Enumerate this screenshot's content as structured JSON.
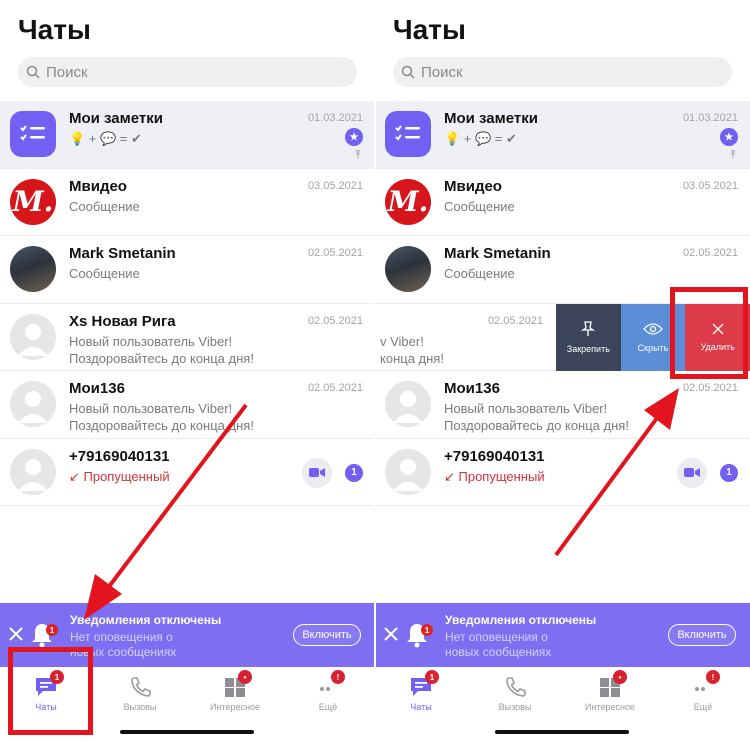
{
  "left": {
    "title": "Чаты",
    "search_placeholder": "Поиск",
    "chats": [
      {
        "name": "Мои заметки",
        "message": "💡 + 💬 = ✔",
        "date": "01.03.2021",
        "avatar": "notes-icon"
      },
      {
        "name": "Мвидео",
        "message": "Сообщение",
        "date": "03.05.2021",
        "avatar": "mvideo-logo",
        "avatar_text": "M."
      },
      {
        "name": "Mark Smetanin",
        "message": "Сообщение",
        "date": "02.05.2021",
        "avatar": "user-photo"
      },
      {
        "name": "Xs Новая Рига",
        "message": "Новый пользователь Viber!\nПоздоровайтесь до конца дня!",
        "date": "02.05.2021",
        "avatar": "placeholder-avatar"
      },
      {
        "name": "Мои136",
        "message": "Новый пользователь Viber!\nПоздоровайтесь до конца дня!",
        "date": "02.05.2021",
        "avatar": "placeholder-avatar"
      },
      {
        "name": "+79169040131",
        "message": "↙ Пропущенный",
        "badge": "1",
        "avatar": "placeholder-avatar"
      }
    ],
    "banner": {
      "title": "Уведомления отключены",
      "subtitle": "Нет оповещения о\nновых сообщениях",
      "button": "Включить",
      "bell_badge": "1"
    },
    "tabs": [
      {
        "label": "Чаты",
        "badge": "1",
        "icon": "chat-bubble-icon"
      },
      {
        "label": "Вызовы",
        "icon": "phone-icon"
      },
      {
        "label": "Интересное",
        "badge": "•",
        "icon": "explore-icon"
      },
      {
        "label": "Ещё",
        "badge": "!",
        "icon": "more-icon"
      }
    ]
  },
  "right": {
    "title": "Чаты",
    "search_placeholder": "Поиск",
    "chats": [
      {
        "name": "Мои заметки",
        "message": "💡 + 💬 = ✔",
        "date": "01.03.2021"
      },
      {
        "name": "Мвидео",
        "message": "Сообщение",
        "date": "03.05.2021",
        "avatar_text": "M."
      },
      {
        "name": "Mark Smetanin",
        "message": "Сообщение",
        "date": "02.05.2021"
      },
      {
        "swiped_message": "v Viber!\nконца дня!",
        "date": "02.05.2021"
      },
      {
        "name": "Мои136",
        "message": "Новый пользователь Viber!\nПоздоровайтесь до конца дня!",
        "date": "02.05.2021"
      },
      {
        "name": "+79169040131",
        "message": "↙ Пропущенный",
        "badge": "1"
      }
    ],
    "swipe_actions": [
      {
        "label": "Закрепить",
        "icon": "pin-icon"
      },
      {
        "label": "Скрыть",
        "icon": "eye-icon"
      },
      {
        "label": "Удалить",
        "icon": "close-icon"
      }
    ],
    "banner": {
      "title": "Уведомления отключены",
      "subtitle": "Нет оповещения о\nновых сообщениях",
      "button": "Включить",
      "bell_badge": "1"
    },
    "tabs": [
      {
        "label": "Чаты",
        "badge": "1"
      },
      {
        "label": "Вызовы"
      },
      {
        "label": "Интересное",
        "badge": "•"
      },
      {
        "label": "Ещё",
        "badge": "!"
      }
    ]
  },
  "colors": {
    "viber_purple": "#7360f2",
    "banner_purple": "#7e6ef2",
    "highlight_red": "#e3141e",
    "delete_red": "#dd3a4a"
  }
}
